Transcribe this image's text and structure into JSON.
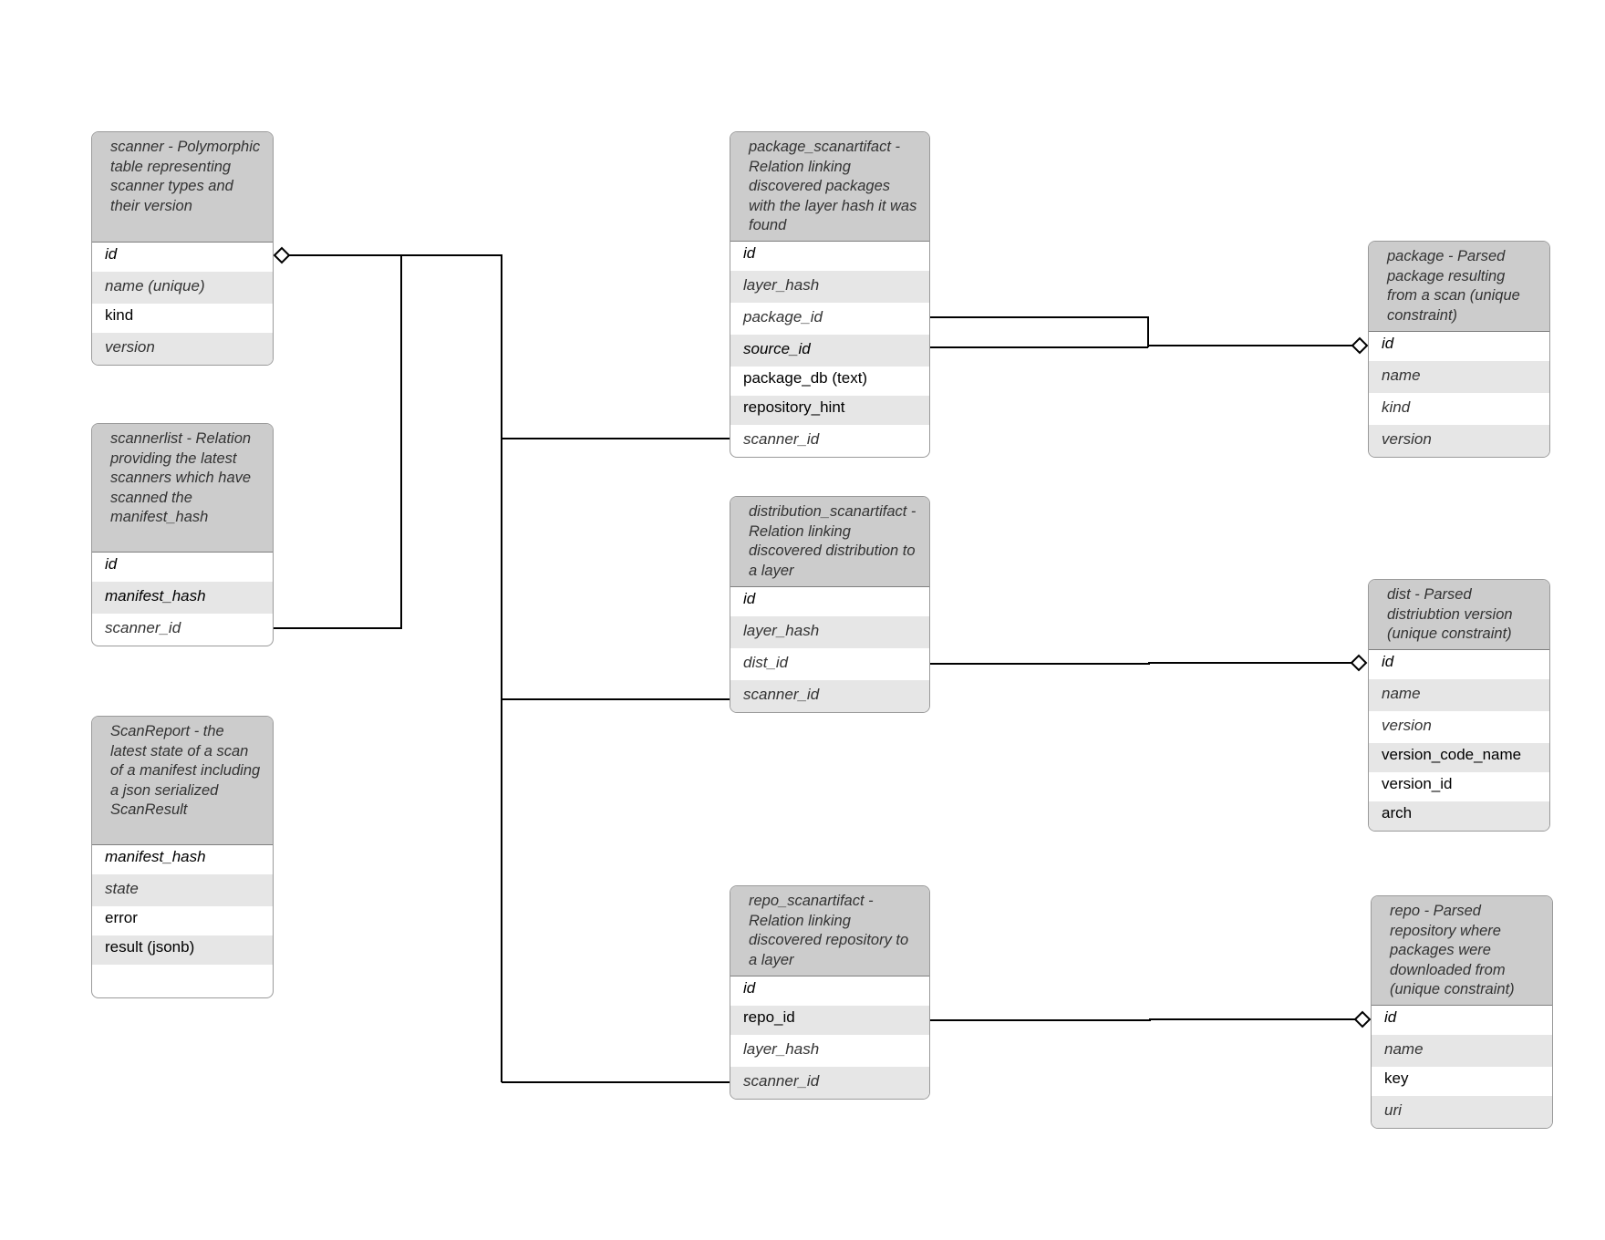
{
  "diagram": {
    "type": "entity-relationship",
    "entities": [
      {
        "key": "scanner",
        "title": "scanner - Polymorphic table representing scanner types and their version",
        "fields": [
          {
            "name": "id",
            "style": "italic"
          },
          {
            "name": "name (unique)",
            "style": "italic-gray"
          },
          {
            "name": "kind",
            "style": "normal"
          },
          {
            "name": "version",
            "style": "italic-gray"
          }
        ]
      },
      {
        "key": "scannerlist",
        "title": "scannerlist - Relation providing the latest scanners which have scanned the manifest_hash",
        "fields": [
          {
            "name": "id",
            "style": "italic"
          },
          {
            "name": "manifest_hash",
            "style": "italic"
          },
          {
            "name": "scanner_id",
            "style": "italic-gray"
          }
        ]
      },
      {
        "key": "scanreport",
        "title": "ScanReport - the latest state of a scan of a manifest including a json serialized ScanResult",
        "fields": [
          {
            "name": "manifest_hash",
            "style": "italic"
          },
          {
            "name": "state",
            "style": "italic-gray"
          },
          {
            "name": "error",
            "style": "normal"
          },
          {
            "name": "result (jsonb)",
            "style": "normal"
          },
          {
            "name": "",
            "style": "normal"
          }
        ]
      },
      {
        "key": "package_scanartifact",
        "title": "package_scanartifact - Relation linking discovered packages with the layer hash it was found",
        "fields": [
          {
            "name": "id",
            "style": "italic"
          },
          {
            "name": "layer_hash",
            "style": "italic-gray"
          },
          {
            "name": "package_id",
            "style": "italic-gray"
          },
          {
            "name": "source_id",
            "style": "italic"
          },
          {
            "name": "package_db (text)",
            "style": "normal"
          },
          {
            "name": "repository_hint",
            "style": "normal"
          },
          {
            "name": "scanner_id",
            "style": "italic-gray"
          }
        ]
      },
      {
        "key": "distribution_scanartifact",
        "title": "distribution_scanartifact - Relation linking discovered distribution to a layer",
        "fields": [
          {
            "name": "id",
            "style": "italic"
          },
          {
            "name": "layer_hash",
            "style": "italic-gray"
          },
          {
            "name": "dist_id",
            "style": "italic-gray"
          },
          {
            "name": "scanner_id",
            "style": "italic-gray"
          }
        ]
      },
      {
        "key": "repo_scanartifact",
        "title": "repo_scanartifact - Relation linking discovered repository to a layer",
        "fields": [
          {
            "name": "id",
            "style": "italic"
          },
          {
            "name": "repo_id",
            "style": "normal"
          },
          {
            "name": "layer_hash",
            "style": "italic-gray"
          },
          {
            "name": "scanner_id",
            "style": "italic-gray"
          }
        ]
      },
      {
        "key": "package",
        "title": "package - Parsed package resulting from a scan (unique constraint)",
        "fields": [
          {
            "name": "id",
            "style": "italic"
          },
          {
            "name": "name",
            "style": "italic-gray"
          },
          {
            "name": "kind",
            "style": "italic-gray"
          },
          {
            "name": "version",
            "style": "italic-gray"
          }
        ]
      },
      {
        "key": "dist",
        "title": "dist - Parsed distriubtion version (unique constraint)",
        "fields": [
          {
            "name": "id",
            "style": "italic"
          },
          {
            "name": "name",
            "style": "italic-gray"
          },
          {
            "name": "version",
            "style": "italic-gray"
          },
          {
            "name": "version_code_name",
            "style": "normal"
          },
          {
            "name": "version_id",
            "style": "normal"
          },
          {
            "name": "arch",
            "style": "normal"
          }
        ]
      },
      {
        "key": "repo",
        "title": "repo - Parsed repository where packages were downloaded from (unique constraint)",
        "fields": [
          {
            "name": "id",
            "style": "italic"
          },
          {
            "name": "name",
            "style": "italic-gray"
          },
          {
            "name": "key",
            "style": "normal"
          },
          {
            "name": "uri",
            "style": "italic-gray"
          }
        ]
      }
    ],
    "relationships": [
      {
        "from": "scannerlist.scanner_id",
        "to": "scanner.id",
        "end": "diamond"
      },
      {
        "from": "package_scanartifact.scanner_id",
        "to": "scanner.id",
        "end": "diamond"
      },
      {
        "from": "distribution_scanartifact.scanner_id",
        "to": "scanner.id",
        "end": "diamond"
      },
      {
        "from": "repo_scanartifact.scanner_id",
        "to": "scanner.id",
        "end": "diamond"
      },
      {
        "from": "package_scanartifact.package_id",
        "to": "package.id",
        "end": "diamond"
      },
      {
        "from": "package_scanartifact.source_id",
        "to": "package.id",
        "end": "diamond"
      },
      {
        "from": "distribution_scanartifact.dist_id",
        "to": "dist.id",
        "end": "diamond"
      },
      {
        "from": "repo_scanartifact.repo_id",
        "to": "repo.id",
        "end": "diamond"
      }
    ]
  }
}
